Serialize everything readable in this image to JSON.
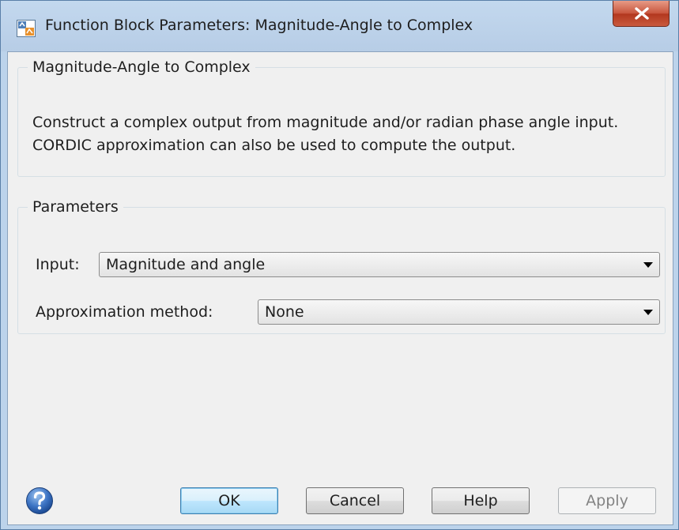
{
  "window": {
    "title": "Function Block Parameters: Magnitude-Angle to Complex",
    "icon": "simulink-block-icon",
    "close_icon": "close-icon"
  },
  "description_group": {
    "legend": "Magnitude-Angle to Complex",
    "text": "Construct a complex output from magnitude and/or radian phase angle input. CORDIC approximation can also be used to compute the output."
  },
  "parameters_group": {
    "legend": "Parameters",
    "input": {
      "label": "Input:",
      "value": "Magnitude and angle"
    },
    "approximation": {
      "label": "Approximation method:",
      "value": "None"
    }
  },
  "footer": {
    "help_icon": "help-icon",
    "ok_label": "OK",
    "cancel_label": "Cancel",
    "help_label": "Help",
    "apply_label": "Apply",
    "apply_enabled": false
  },
  "colors": {
    "frame": "#bcd3eb",
    "client_background": "#f0f0f0",
    "close_button": "#c8553d",
    "default_button": "#bee6fd"
  }
}
